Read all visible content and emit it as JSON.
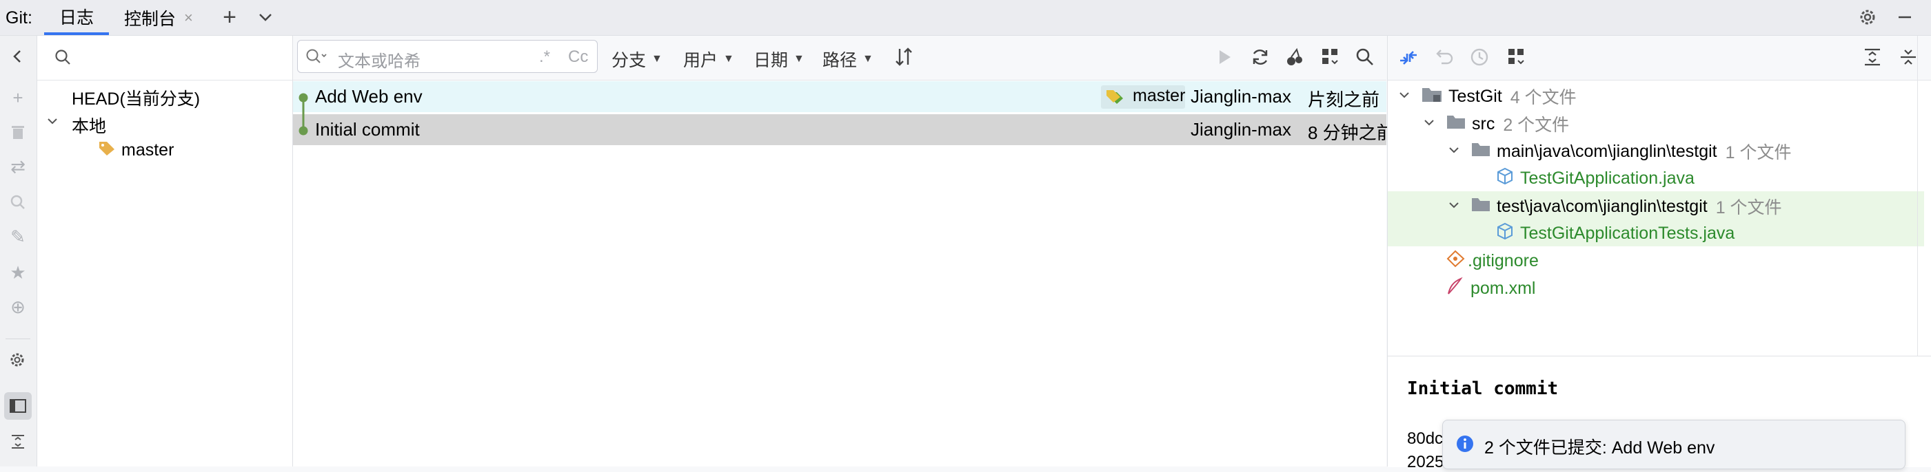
{
  "topbar": {
    "git_label": "Git:",
    "tabs": [
      {
        "label": "日志"
      },
      {
        "label": "控制台"
      }
    ],
    "close_glyph": "×",
    "add_glyph": "+",
    "chevron_glyph": "⌄"
  },
  "branches": {
    "head": "HEAD(当前分支)",
    "local": "本地",
    "master": "master"
  },
  "log_toolbar": {
    "search_placeholder": "文本或哈希",
    "regex_glyph": ".*",
    "case_glyph": "Cc",
    "filters": [
      "分支",
      "用户",
      "日期",
      "路径"
    ]
  },
  "commits": [
    {
      "message": "Add Web env",
      "branch_tag": "master",
      "author": "Jianglin-max",
      "date": "片刻之前"
    },
    {
      "message": "Initial commit",
      "branch_tag": "",
      "author": "Jianglin-max",
      "date": "8 分钟之前"
    }
  ],
  "changes_tree": {
    "root": "TestGit",
    "root_count": "4 个文件",
    "src": "src",
    "src_count": "2 个文件",
    "main_path": "main\\java\\com\\jianglin\\testgit",
    "main_count": "1 个文件",
    "main_file": "TestGitApplication.java",
    "test_path": "test\\java\\com\\jianglin\\testgit",
    "test_count": "1 个文件",
    "test_file": "TestGitApplicationTests.java",
    "gitignore": ".gitignore",
    "pom": "pom.xml"
  },
  "details": {
    "title": "Initial commit",
    "hash_partial": "80dc",
    "date_partial": "2025"
  },
  "notification": {
    "text": "2 个文件已提交: Add Web env"
  },
  "colors": {
    "accent": "#3574f0",
    "selected_row": "#d5d5d5",
    "highlight_row": "#e6f7fa",
    "graph": "#6b9b4d",
    "added_green": "#2c8a2c",
    "tree_highlight": "#eaf7e6",
    "tag_bg": "#d8e9ec"
  }
}
